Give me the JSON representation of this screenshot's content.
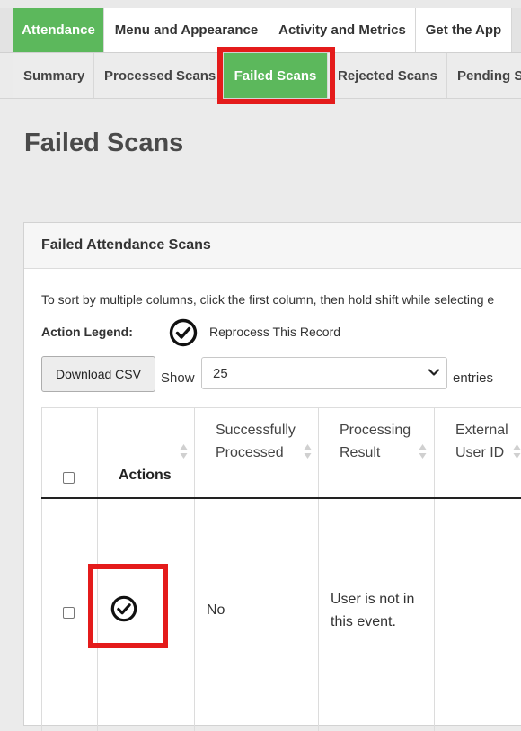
{
  "top_tabs": [
    {
      "label": "Attendance",
      "active": true
    },
    {
      "label": "Menu and Appearance",
      "active": false
    },
    {
      "label": "Activity and Metrics",
      "active": false
    },
    {
      "label": "Get the App",
      "active": false
    }
  ],
  "sub_tabs": [
    {
      "label": "Summary",
      "active": false
    },
    {
      "label": "Processed Scans",
      "active": false
    },
    {
      "label": "Failed Scans",
      "active": true
    },
    {
      "label": "Rejected Scans",
      "active": false
    },
    {
      "label": "Pending S",
      "active": false
    }
  ],
  "page": {
    "title": "Failed Scans"
  },
  "panel": {
    "title": "Failed Attendance Scans",
    "sort_hint": "To sort by multiple columns, click the first column, then hold shift while selecting e",
    "legend_label": "Action Legend:",
    "legend_text": "Reprocess This Record",
    "legend_icon": "check-circle-icon",
    "download_label": "Download CSV",
    "show_label": "Show",
    "entries_value": "25",
    "entries_label": "entries"
  },
  "table": {
    "headers": [
      "",
      "Actions",
      "Successfully Processed",
      "Processing Result",
      "External User ID"
    ],
    "header_lines": {
      "successfully_processed": [
        "Successfully",
        "Processed"
      ],
      "processing_result": [
        "Processing",
        "Result"
      ],
      "external_user_id": [
        "External",
        "User ID"
      ]
    },
    "rows": [
      {
        "action_icon": "check-circle-icon",
        "successfully_processed": "No",
        "processing_result_lines": [
          "User is not in",
          "this event."
        ],
        "external_user_id": ""
      }
    ]
  },
  "colors": {
    "accent": "#5cb85c",
    "highlight": "#e41b1b",
    "heading": "#4a4a4a"
  }
}
